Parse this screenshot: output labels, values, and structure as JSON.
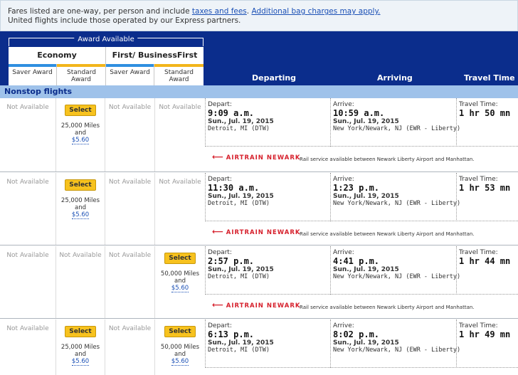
{
  "notice": {
    "line1_pre": "Fares listed are one-way, per person and include ",
    "taxes_link": "taxes and fees",
    "bag_link": "Additional bag charges may apply.",
    "line2": "United flights include those operated by our Express partners."
  },
  "header": {
    "award_available": "Award Available",
    "economy": "Economy",
    "first_business": "First/ BusinessFirst",
    "saver_award": "Saver Award",
    "standard_award": "Standard Award",
    "departing": "Departing",
    "arriving": "Arriving",
    "travel_time": "Travel Time",
    "saver_color": "#2f8fe0",
    "standard_color": "#f2b51b"
  },
  "section_label": "Nonstop flights",
  "common": {
    "not_available": "Not Available",
    "select": "Select",
    "and": "and",
    "fee": "$5.60",
    "depart_label": "Depart:",
    "arrive_label": "Arrive:",
    "travel_label": "Travel Time:",
    "airtrain_logo": "AIRTRAIN NEWARK",
    "airtrain_text": "Rail service available between Newark Liberty Airport and Manhattan."
  },
  "flights": [
    {
      "eco_saver": "Not Available",
      "eco_standard_miles": "25,000 Miles",
      "first_saver": "Not Available",
      "first_standard": "Not Available",
      "depart_time": "9:09 a.m.",
      "depart_date": "Sun., Jul. 19, 2015",
      "depart_city": "Detroit, MI (DTW)",
      "arrive_time": "10:59 a.m.",
      "arrive_date": "Sun., Jul. 19, 2015",
      "arrive_city": "New York/Newark, NJ (EWR - Liberty)",
      "travel_time": "1 hr 50 mn"
    },
    {
      "eco_saver": "Not Available",
      "eco_standard_miles": "25,000 Miles",
      "first_saver": "Not Available",
      "first_standard": "Not Available",
      "depart_time": "11:30 a.m.",
      "depart_date": "Sun., Jul. 19, 2015",
      "depart_city": "Detroit, MI (DTW)",
      "arrive_time": "1:23 p.m.",
      "arrive_date": "Sun., Jul. 19, 2015",
      "arrive_city": "New York/Newark, NJ (EWR - Liberty)",
      "travel_time": "1 hr 53 mn"
    },
    {
      "eco_saver": "Not Available",
      "eco_standard": "Not Available",
      "first_saver": "Not Available",
      "first_standard_miles": "50,000 Miles",
      "depart_time": "2:57 p.m.",
      "depart_date": "Sun., Jul. 19, 2015",
      "depart_city": "Detroit, MI (DTW)",
      "arrive_time": "4:41 p.m.",
      "arrive_date": "Sun., Jul. 19, 2015",
      "arrive_city": "New York/Newark, NJ (EWR - Liberty)",
      "travel_time": "1 hr 44 mn"
    },
    {
      "eco_saver": "Not Available",
      "eco_standard_miles": "25,000 Miles",
      "first_saver": "Not Available",
      "first_standard_miles": "50,000 Miles",
      "depart_time": "6:13 p.m.",
      "depart_date": "Sun., Jul. 19, 2015",
      "depart_city": "Detroit, MI (DTW)",
      "arrive_time": "8:02 p.m.",
      "arrive_date": "Sun., Jul. 19, 2015",
      "arrive_city": "New York/Newark, NJ (EWR - Liberty)",
      "travel_time": "1 hr 49 mn"
    }
  ]
}
